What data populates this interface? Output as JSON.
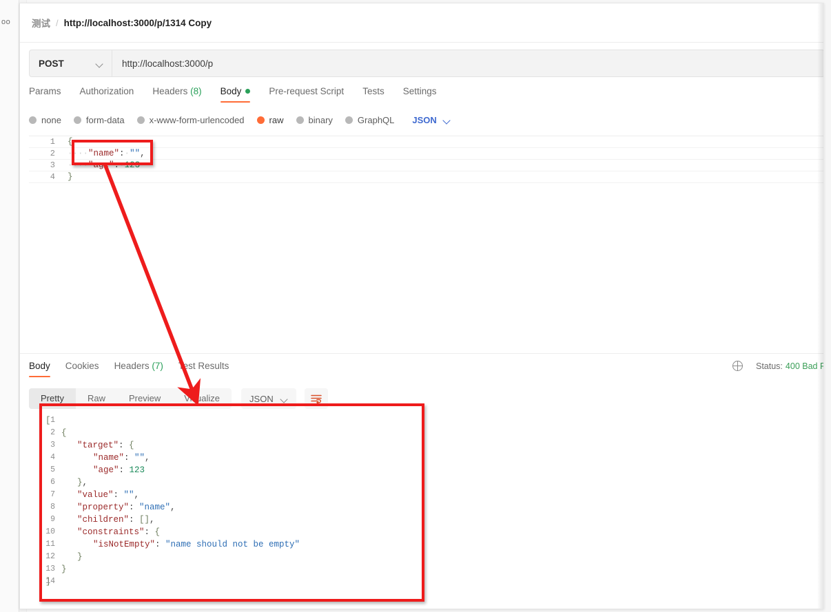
{
  "sidebar": {
    "ghost_text": "oo"
  },
  "breadcrumb": {
    "workspace": "测试",
    "separator": "/",
    "title": "http://localhost:3000/p/1314 Copy"
  },
  "request": {
    "method": "POST",
    "url": "http://localhost:3000/p",
    "tabs": [
      {
        "label": "Params",
        "count": "",
        "active": false
      },
      {
        "label": "Authorization",
        "count": "",
        "active": false
      },
      {
        "label": "Headers",
        "count": "(8)",
        "active": false
      },
      {
        "label": "Body",
        "count": "",
        "active": true,
        "dot": true
      },
      {
        "label": "Pre-request Script",
        "count": "",
        "active": false
      },
      {
        "label": "Tests",
        "count": "",
        "active": false
      },
      {
        "label": "Settings",
        "count": "",
        "active": false
      }
    ],
    "body_types": [
      {
        "label": "none",
        "selected": false
      },
      {
        "label": "form-data",
        "selected": false
      },
      {
        "label": "x-www-form-urlencoded",
        "selected": false
      },
      {
        "label": "raw",
        "selected": true
      },
      {
        "label": "binary",
        "selected": false
      },
      {
        "label": "GraphQL",
        "selected": false
      }
    ],
    "format": "JSON",
    "body_lines": [
      {
        "n": "1",
        "tokens": [
          {
            "t": "{",
            "c": "t-brace"
          }
        ]
      },
      {
        "n": "2",
        "tokens": [
          {
            "t": "····",
            "c": "t-ws"
          },
          {
            "t": "\"name\"",
            "c": "t-key"
          },
          {
            "t": ":",
            "c": "t-punct"
          },
          {
            "t": "·",
            "c": "t-ws"
          },
          {
            "t": "\"\"",
            "c": "t-str"
          },
          {
            "t": ",",
            "c": "t-punct"
          }
        ]
      },
      {
        "n": "3",
        "tokens": [
          {
            "t": "····",
            "c": "t-ws"
          },
          {
            "t": "\"age\"",
            "c": "t-key"
          },
          {
            "t": ":",
            "c": "t-punct"
          },
          {
            "t": "·",
            "c": "t-ws"
          },
          {
            "t": "123",
            "c": "t-num"
          }
        ]
      },
      {
        "n": "4",
        "tokens": [
          {
            "t": "}",
            "c": "t-brace"
          }
        ]
      }
    ]
  },
  "response": {
    "tabs": [
      {
        "label": "Body",
        "count": "",
        "active": true
      },
      {
        "label": "Cookies",
        "count": "",
        "active": false
      },
      {
        "label": "Headers",
        "count": "(7)",
        "active": false
      },
      {
        "label": "Test Results",
        "count": "",
        "active": false
      }
    ],
    "status_label": "Status:",
    "status_value": "400 Bad R",
    "view_modes": [
      {
        "label": "Pretty",
        "active": true
      },
      {
        "label": "Raw",
        "active": false
      },
      {
        "label": "Preview",
        "active": false
      },
      {
        "label": "Visualize",
        "active": false
      }
    ],
    "format": "JSON",
    "body_lines": [
      {
        "n": "1",
        "indent": 0,
        "tokens": [
          {
            "t": "[",
            "c": "t-brace"
          }
        ]
      },
      {
        "n": "2",
        "indent": 1,
        "tokens": [
          {
            "t": "{",
            "c": "t-brace"
          }
        ]
      },
      {
        "n": "3",
        "indent": 2,
        "tokens": [
          {
            "t": "\"target\"",
            "c": "t-key"
          },
          {
            "t": ": ",
            "c": "t-punct"
          },
          {
            "t": "{",
            "c": "t-brace"
          }
        ]
      },
      {
        "n": "4",
        "indent": 3,
        "tokens": [
          {
            "t": "\"name\"",
            "c": "t-key"
          },
          {
            "t": ": ",
            "c": "t-punct"
          },
          {
            "t": "\"\"",
            "c": "t-str"
          },
          {
            "t": ",",
            "c": "t-punct"
          }
        ]
      },
      {
        "n": "5",
        "indent": 3,
        "tokens": [
          {
            "t": "\"age\"",
            "c": "t-key"
          },
          {
            "t": ": ",
            "c": "t-punct"
          },
          {
            "t": "123",
            "c": "t-num"
          }
        ]
      },
      {
        "n": "6",
        "indent": 2,
        "tokens": [
          {
            "t": "}",
            "c": "t-brace"
          },
          {
            "t": ",",
            "c": "t-punct"
          }
        ]
      },
      {
        "n": "7",
        "indent": 2,
        "tokens": [
          {
            "t": "\"value\"",
            "c": "t-key"
          },
          {
            "t": ": ",
            "c": "t-punct"
          },
          {
            "t": "\"\"",
            "c": "t-str"
          },
          {
            "t": ",",
            "c": "t-punct"
          }
        ]
      },
      {
        "n": "8",
        "indent": 2,
        "tokens": [
          {
            "t": "\"property\"",
            "c": "t-key"
          },
          {
            "t": ": ",
            "c": "t-punct"
          },
          {
            "t": "\"name\"",
            "c": "t-str"
          },
          {
            "t": ",",
            "c": "t-punct"
          }
        ]
      },
      {
        "n": "9",
        "indent": 2,
        "tokens": [
          {
            "t": "\"children\"",
            "c": "t-key"
          },
          {
            "t": ": ",
            "c": "t-punct"
          },
          {
            "t": "[]",
            "c": "t-brace"
          },
          {
            "t": ",",
            "c": "t-punct"
          }
        ]
      },
      {
        "n": "10",
        "indent": 2,
        "tokens": [
          {
            "t": "\"constraints\"",
            "c": "t-key"
          },
          {
            "t": ": ",
            "c": "t-punct"
          },
          {
            "t": "{",
            "c": "t-brace"
          }
        ]
      },
      {
        "n": "11",
        "indent": 3,
        "tokens": [
          {
            "t": "\"isNotEmpty\"",
            "c": "t-key"
          },
          {
            "t": ": ",
            "c": "t-punct"
          },
          {
            "t": "\"name should not be empty\"",
            "c": "t-str"
          }
        ]
      },
      {
        "n": "12",
        "indent": 2,
        "tokens": [
          {
            "t": "}",
            "c": "t-brace"
          }
        ]
      },
      {
        "n": "13",
        "indent": 1,
        "tokens": [
          {
            "t": "}",
            "c": "t-brace"
          }
        ]
      },
      {
        "n": "14",
        "indent": 0,
        "tokens": [
          {
            "t": "]",
            "c": "t-brace"
          }
        ]
      }
    ]
  },
  "annotations": {
    "highlight_color": "#ee1c1c",
    "boxes": [
      {
        "name": "request-name-field-highlight"
      },
      {
        "name": "response-body-highlight"
      }
    ],
    "arrow": {
      "name": "pointer-arrow",
      "from": "request name line",
      "to": "response body box"
    }
  }
}
